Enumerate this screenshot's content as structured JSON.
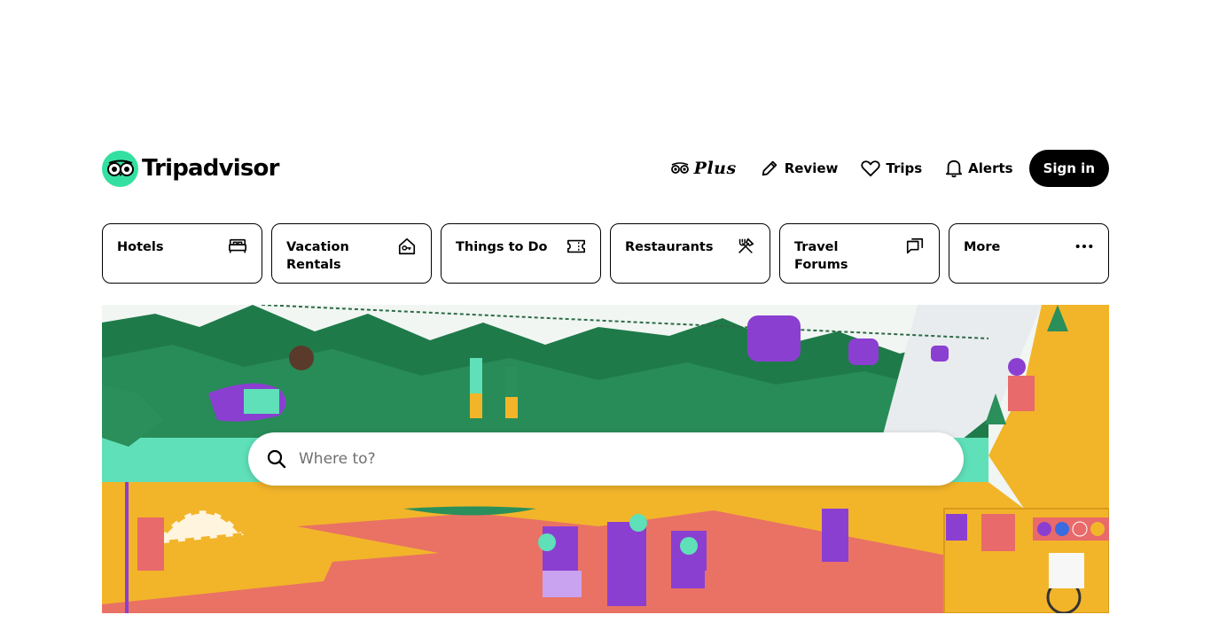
{
  "brand": {
    "name": "Tripadvisor",
    "accent": "#34e0a1"
  },
  "header": {
    "plus_label": "Plus",
    "review_label": "Review",
    "trips_label": "Trips",
    "alerts_label": "Alerts",
    "signin_label": "Sign in"
  },
  "categories": [
    {
      "label": "Hotels",
      "icon": "bed-icon"
    },
    {
      "label": "Vacation Rentals",
      "icon": "house-key-icon"
    },
    {
      "label": "Things to Do",
      "icon": "ticket-icon"
    },
    {
      "label": "Restaurants",
      "icon": "utensils-icon"
    },
    {
      "label": "Travel Forums",
      "icon": "speech-bubbles-icon"
    },
    {
      "label": "More",
      "icon": "ellipsis-icon"
    }
  ],
  "search": {
    "placeholder": "Where to?"
  },
  "colors": {
    "hero_mountain": "#1f7a4a",
    "hero_sand": "#f2b52a",
    "hero_water": "#5fe0b8",
    "hero_path": "#e86a6a",
    "hero_purple": "#8b3fd1"
  }
}
